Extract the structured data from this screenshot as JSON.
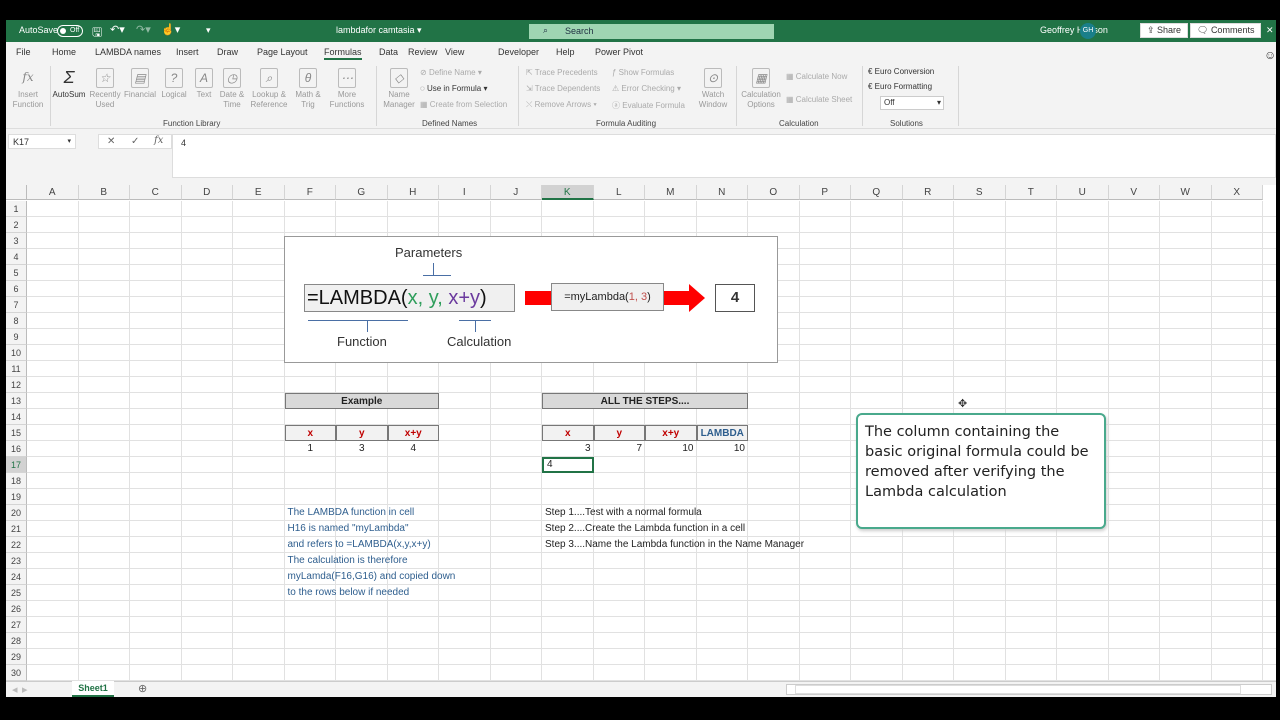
{
  "titlebar": {
    "autosave": "AutoSave",
    "autosave_state": "Off",
    "filename": "lambdafor camtasia ▾",
    "search_placeholder": "Search",
    "user": "Geoffrey Hudson",
    "initials": "GH",
    "accent": "#217346"
  },
  "menu": {
    "tabs": [
      "File",
      "Home",
      "LAMBDA names",
      "Insert",
      "Draw",
      "Page Layout",
      "Formulas",
      "Data",
      "Review",
      "View",
      "Developer",
      "Help",
      "Power Pivot"
    ],
    "active": "Formulas",
    "share": "Share",
    "comments": "Comments"
  },
  "ribbon": {
    "function_library": {
      "label": "Function Library",
      "buttons": [
        "Insert Function",
        "AutoSum",
        "Recently Used",
        "Financial",
        "Logical",
        "Text",
        "Date & Time",
        "Lookup & Reference",
        "Math & Trig",
        "More Functions"
      ]
    },
    "defined_names": {
      "label": "Defined Names",
      "name_manager": "Name Manager",
      "items": [
        "Define Name",
        "Use in Formula",
        "Create from Selection"
      ]
    },
    "formula_auditing": {
      "label": "Formula Auditing",
      "items": [
        "Trace Precedents",
        "Trace Dependents",
        "Remove Arrows",
        "Show Formulas",
        "Error Checking",
        "Evaluate Formula"
      ],
      "watch": "Watch Window"
    },
    "calculation": {
      "label": "Calculation",
      "options": "Calculation Options",
      "items": [
        "Calculate Now",
        "Calculate Sheet"
      ]
    },
    "solutions": {
      "label": "Solutions",
      "items": [
        "Euro Conversion",
        "Euro Formatting"
      ],
      "select": "Off"
    }
  },
  "formula_bar": {
    "name_box": "K17",
    "value": "4"
  },
  "columns": [
    "A",
    "B",
    "C",
    "D",
    "E",
    "F",
    "G",
    "H",
    "I",
    "J",
    "K",
    "L",
    "M",
    "N",
    "O",
    "P",
    "Q",
    "R",
    "S",
    "T",
    "U",
    "V",
    "W",
    "X"
  ],
  "rows": [
    "1",
    "2",
    "3",
    "4",
    "5",
    "6",
    "7",
    "8",
    "9",
    "10",
    "11",
    "12",
    "13",
    "14",
    "15",
    "16",
    "17",
    "18",
    "19",
    "20",
    "21",
    "22",
    "23",
    "24",
    "25",
    "26",
    "27",
    "28",
    "29",
    "30"
  ],
  "selected_cell": "K17",
  "diagram": {
    "parameters": "Parameters",
    "formula_prefix": "=LAMBDA(",
    "x": "x, ",
    "y": "y, ",
    "calc": "x+y",
    "close": ")",
    "function_label": "Function",
    "calculation_label": "Calculation",
    "call_prefix": "=myLambda(",
    "call_args": "1, 3",
    "call_close": ")",
    "result": "4",
    "arrow_color": "#ff0000"
  },
  "example": {
    "title": "Example",
    "headers": [
      "x",
      "y",
      "x+y"
    ],
    "values": [
      "1",
      "3",
      "4"
    ]
  },
  "steps": {
    "title": "ALL THE STEPS....",
    "headers": [
      "x",
      "y",
      "x+y",
      "LAMBDA"
    ],
    "values": [
      "3",
      "7",
      "10",
      "10"
    ],
    "k17": "4",
    "lines": [
      "Step 1....Test with a normal formula",
      "Step 2....Create the Lambda function in a cell",
      "Step 3....Name the Lambda function in the Name Manager"
    ]
  },
  "notes": [
    "The LAMBDA function in cell",
    "H16 is named \"myLambda\"",
    "and refers to =LAMBDA(x,y,x+y)",
    "The calculation is therefore",
    "myLamda(F16,G16) and copied down",
    "to the rows below if needed"
  ],
  "callout": "The column containing the basic original formula could be removed after verifying the Lambda calculation",
  "sheet_tabs": {
    "active": "Sheet1"
  }
}
